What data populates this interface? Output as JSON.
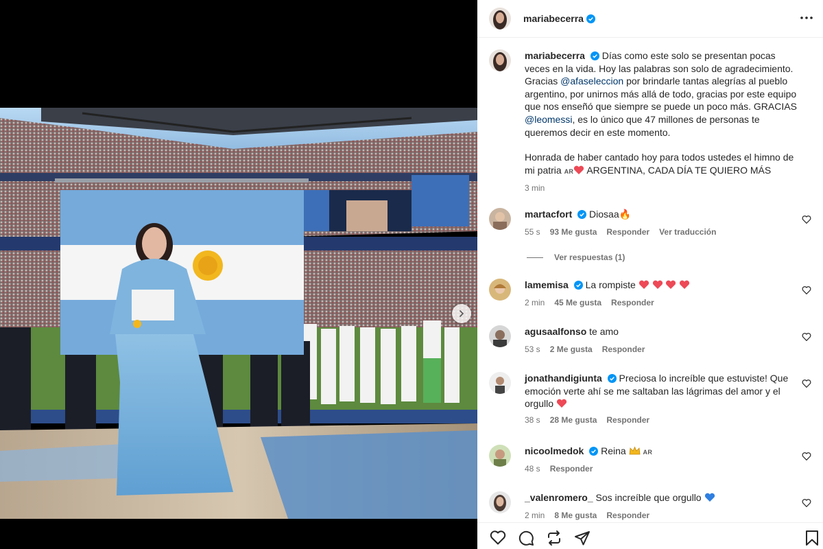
{
  "post": {
    "author": "mariabecerra",
    "caption_intro": "Días como este solo se presentan pocas veces en la vida. Hoy las palabras son solo de agradecimiento. Gracias",
    "mention1": "@afaseleccion",
    "caption_mid": "por brindarle tantas alegrías al pueblo argentino, por unirnos más allá de todo, gracias por este equipo que nos enseñó que siempre se puede un poco más. GRACIAS",
    "mention2": "@leomessi",
    "caption_end": ", es lo único que 47 millones de personas te queremos decir en este momento.",
    "caption_p2": "Honrada de haber cantado hoy para todos ustedes el himno de mi patria",
    "flag_code": "AR",
    "caption_p2_end": "ARGENTINA, CADA DÍA TE QUIERO MÁS",
    "time": "3 min"
  },
  "comments": [
    {
      "user": "martacfort",
      "verified": true,
      "text": "Diosaa🔥",
      "time": "55 s",
      "likes": "93 Me gusta",
      "reply": "Responder",
      "translate": "Ver traducción"
    },
    {
      "user": "lamemisa",
      "verified": true,
      "text": "La rompiste",
      "time": "2 min",
      "likes": "45 Me gusta",
      "reply": "Responder"
    },
    {
      "user": "agusaalfonso",
      "verified": false,
      "text": "te amo",
      "time": "53 s",
      "likes": "2 Me gusta",
      "reply": "Responder"
    },
    {
      "user": "jonathandigiunta",
      "verified": true,
      "text": "Preciosa lo increíble que estuviste! Que emoción verte ahí se me saltaban las lágrimas del amor y el orgullo",
      "time": "38 s",
      "likes": "28 Me gusta",
      "reply": "Responder"
    },
    {
      "user": "nicoolmedok",
      "verified": true,
      "text": "Reina",
      "flag": "AR",
      "time": "48 s",
      "reply": "Responder"
    },
    {
      "user": "_valenromero_",
      "verified": false,
      "text": "Sos increíble que orgullo",
      "time": "2 min",
      "likes": "8 Me gusta",
      "reply": "Responder"
    }
  ],
  "replies_toggle": "Ver respuestas (1)",
  "icons": {
    "like": "heart-icon",
    "comment": "comment-icon",
    "repost": "repost-icon",
    "share": "send-icon",
    "save": "bookmark-icon",
    "more": "more-icon",
    "verified": "verified-badge-icon"
  },
  "colors": {
    "verified": "#0095f6",
    "mention": "#00376b",
    "meta": "#737373",
    "heart_red": "#ed4956",
    "flag_blue": "#75aadb"
  }
}
